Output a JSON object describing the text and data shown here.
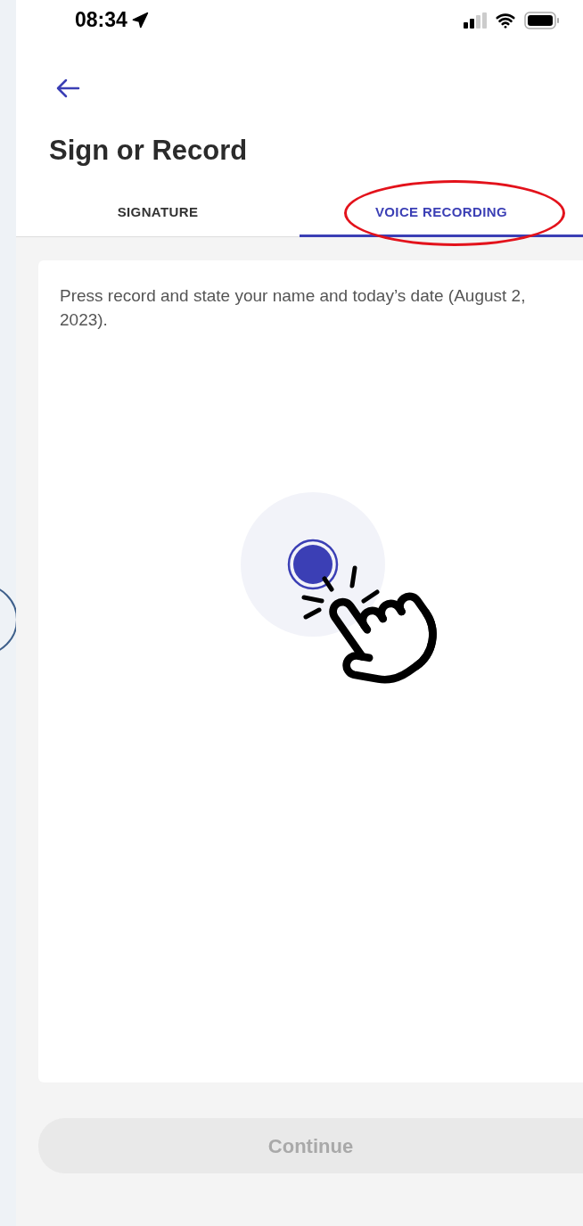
{
  "status_bar": {
    "time": "08:34"
  },
  "title": "Sign or Record",
  "tabs": [
    {
      "label": "SIGNATURE",
      "selected": false
    },
    {
      "label": "VOICE RECORDING",
      "selected": true
    }
  ],
  "instructions": "Press record and state your name and today’s date (August 2, 2023).",
  "continue_button": {
    "label": "Continue",
    "disabled": true
  }
}
